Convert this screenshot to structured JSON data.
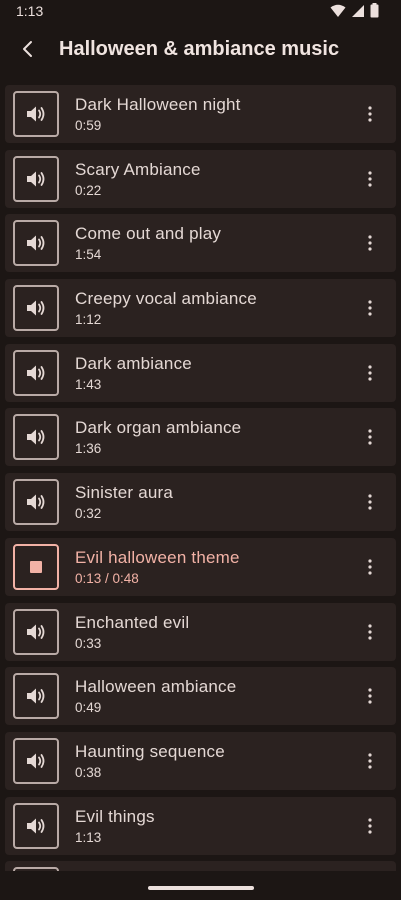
{
  "status": {
    "time": "1:13",
    "icons": [
      "wifi-icon",
      "signal-icon",
      "battery-icon"
    ]
  },
  "header": {
    "back_icon": "arrow-back-icon",
    "title": "Halloween & ambiance music"
  },
  "colors": {
    "background": "#1c1614",
    "card": "#2b2220",
    "accent": "#f2b2a6",
    "text": "#e4d8d4"
  },
  "tracks": [
    {
      "title": "Dark Halloween night",
      "duration": "0:59",
      "state": "idle"
    },
    {
      "title": "Scary Ambiance",
      "duration": "0:22",
      "state": "idle"
    },
    {
      "title": "Come out and play",
      "duration": "1:54",
      "state": "idle"
    },
    {
      "title": "Creepy vocal ambiance",
      "duration": "1:12",
      "state": "idle"
    },
    {
      "title": "Dark ambiance",
      "duration": "1:43",
      "state": "idle"
    },
    {
      "title": "Dark organ ambiance",
      "duration": "1:36",
      "state": "idle"
    },
    {
      "title": "Sinister aura",
      "duration": "0:32",
      "state": "idle"
    },
    {
      "title": "Evil halloween theme",
      "duration": "0:13 / 0:48",
      "state": "playing"
    },
    {
      "title": "Enchanted evil",
      "duration": "0:33",
      "state": "idle"
    },
    {
      "title": "Halloween ambiance",
      "duration": "0:49",
      "state": "idle"
    },
    {
      "title": "Haunting sequence",
      "duration": "0:38",
      "state": "idle"
    },
    {
      "title": "Evil things",
      "duration": "1:13",
      "state": "idle"
    },
    {
      "title": "",
      "duration": "",
      "state": "idle"
    }
  ]
}
